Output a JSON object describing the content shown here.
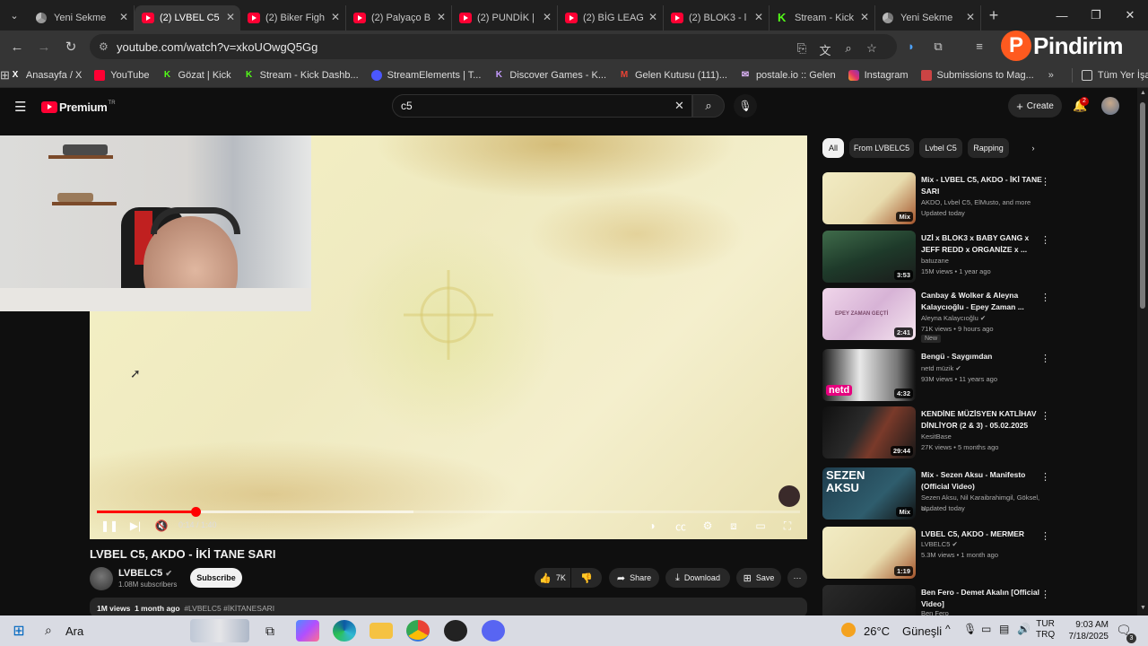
{
  "browser": {
    "tabs": [
      {
        "label": "Yeni Sekme",
        "icon": "chrome-icon"
      },
      {
        "label": "(2) LVBEL C5",
        "icon": "youtube-icon",
        "active": true
      },
      {
        "label": "(2) Biker Figh",
        "icon": "youtube-icon"
      },
      {
        "label": "(2) Palyaço B",
        "icon": "youtube-icon"
      },
      {
        "label": "(2) PUNDİK |",
        "icon": "youtube-icon"
      },
      {
        "label": "(2) BİG LEAG",
        "icon": "youtube-icon"
      },
      {
        "label": "(2) BLOK3 - l",
        "icon": "youtube-icon"
      },
      {
        "label": "Stream - Kick",
        "icon": "kick-icon"
      },
      {
        "label": "Yeni Sekme",
        "icon": "chrome-icon"
      }
    ],
    "url": "youtube.com/watch?v=xkoUOwgQ5Gg",
    "bookmarks": [
      {
        "label": "Anasayfa / X",
        "icon": "x-icon"
      },
      {
        "label": "YouTube",
        "icon": "youtube-icon"
      },
      {
        "label": "Gözat | Kick",
        "icon": "kick-icon"
      },
      {
        "label": "Stream - Kick Dashb...",
        "icon": "kick-icon"
      },
      {
        "label": "StreamElements | T...",
        "icon": "streamelements-icon"
      },
      {
        "label": "Discover Games - K...",
        "icon": "kick-games-icon"
      },
      {
        "label": "Gelen Kutusu (111)...",
        "icon": "gmail-icon"
      },
      {
        "label": "postale.io :: Gelen",
        "icon": "postale-icon"
      },
      {
        "label": "Instagram",
        "icon": "instagram-icon"
      },
      {
        "label": "Submissions to Mag...",
        "icon": "bookmark-icon"
      }
    ],
    "all_bookmarks": "Tüm Yer İşaretleri"
  },
  "watermark": {
    "letter": "P",
    "word": "Pindirim"
  },
  "youtube": {
    "logo_text": "Premium",
    "logo_region": "TR",
    "search_value": "c5",
    "create_label": "Create",
    "notif_count": "2",
    "video": {
      "title": "LVBEL C5, AKDO - İKİ TANE SARI",
      "time": "0:14 / 1:40",
      "progress_fraction": 0.14,
      "channel": "LVBELC5",
      "subscribers": "1.08M subscribers",
      "subscribe_label": "Subscribe",
      "likes": "7K",
      "share_label": "Share",
      "download_label": "Download",
      "save_label": "Save",
      "views": "1M views",
      "age": "1 month ago",
      "hashtags": "#LVBELC5 #İKİTANESARI"
    },
    "chips": [
      "All",
      "From LVBELC5",
      "Lvbel C5",
      "Rapping"
    ],
    "recommendations": [
      {
        "title": "Mix - LVBEL C5, AKDO - İKİ TANE SARI",
        "meta1": "AKDO, Lvbel C5, ElMusto, and more",
        "meta2": "Updated today",
        "duration": "Mix"
      },
      {
        "title": "UZİ x BLOK3 x BABY GANG x JEFF REDD x ORGANİZE x ...",
        "meta1": "batuzane",
        "meta2": "15M views • 1 year ago",
        "duration": "3:53"
      },
      {
        "title": "Canbay & Wolker & Aleyna Kalaycıoğlu - Epey Zaman ...",
        "meta1": "Aleyna Kalaycıoğlu",
        "meta2": "71K views • 9 hours ago",
        "duration": "2:41",
        "badge": "New"
      },
      {
        "title": "Bengü - Saygımdan",
        "meta1": "netd müzik",
        "meta2": "93M views • 11 years ago",
        "duration": "4:32"
      },
      {
        "title": "KENDİNE MÜZİSYEN KATLİHAV DİNLİYOR (2 & 3) - 05.02.2025",
        "meta1": "KesitBase",
        "meta2": "27K views • 5 months ago",
        "duration": "29:44"
      },
      {
        "title": "Mix - Sezen Aksu - Manifesto (Official Video)",
        "meta1": "Sezen Aksu, Nil Karaibrahimgil, Göksel, a...",
        "meta2": "Updated today",
        "duration": "Mix"
      },
      {
        "title": "LVBEL C5, AKDO - MERMER",
        "meta1": "LVBELC5",
        "meta2": "5.3M views • 1 month ago",
        "duration": "1:19"
      },
      {
        "title": "Ben Fero - Demet Akalın [Official Video]",
        "meta1": "Ben Fero",
        "meta2": "",
        "duration": ""
      }
    ],
    "thumb_texts": {
      "sezen": "SEZEN AKSU",
      "netd": "netd",
      "epey": "EPEY ZAMAN GEÇTİ"
    }
  },
  "taskbar": {
    "search_label": "Ara",
    "weather_temp": "26°C",
    "weather_text": "Güneşli",
    "lang1": "TUR",
    "lang2": "TRQ",
    "time": "9:03 AM",
    "date": "7/18/2025",
    "notif_count": "3"
  }
}
